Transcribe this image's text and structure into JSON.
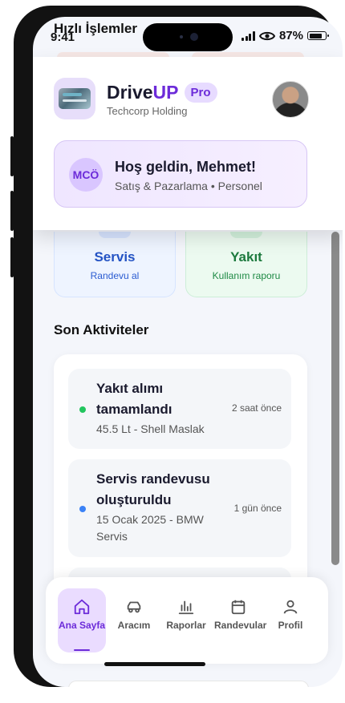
{
  "status_bar": {
    "time": "9:41",
    "battery": "87%"
  },
  "quick_actions": {
    "title": "Hızlı İşlemler",
    "items": [
      {
        "title": "Servis",
        "subtitle": "Randevu al"
      },
      {
        "title": "Yakıt",
        "subtitle": "Kullanım raporu"
      }
    ]
  },
  "header": {
    "brand_prefix": "Drive",
    "brand_suffix": "UP",
    "badge": "Pro",
    "company": "Techcorp Holding"
  },
  "welcome": {
    "initials": "MCÖ",
    "title": "Hoş geldin, Mehmet!",
    "subtitle": "Satış & Pazarlama • Personel"
  },
  "recent": {
    "title": "Son Aktiviteler",
    "items": [
      {
        "title": "Yakıt alımı tamamlandı",
        "detail": "45.5 Lt - Shell Maslak",
        "time": "2 saat önce",
        "status_color": "#22c55e"
      },
      {
        "title": "Servis randevusu oluşturuldu",
        "detail": "15 Ocak 2025 - BMW Servis",
        "time": "1 gün önce",
        "status_color": "#3b82f6"
      }
    ]
  },
  "nav": {
    "items": [
      {
        "label": "Ana Sayfa",
        "icon": "home-icon",
        "active": true
      },
      {
        "label": "Aracım",
        "icon": "car-icon"
      },
      {
        "label": "Raporlar",
        "icon": "bar-chart-icon"
      },
      {
        "label": "Randevular",
        "icon": "calendar-icon"
      },
      {
        "label": "Profil",
        "icon": "user-icon"
      }
    ]
  },
  "colors": {
    "accent": "#6c2bd9",
    "service": "#2453c4",
    "fuel": "#1d7a3e"
  }
}
